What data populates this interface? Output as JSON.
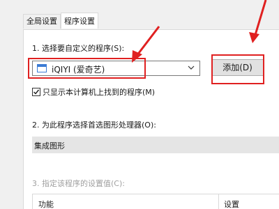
{
  "tabs": [
    {
      "label": "全局设置",
      "active": false
    },
    {
      "label": "程序设置",
      "active": true
    }
  ],
  "section1": {
    "label": "1. 选择要自定义的程序(S):",
    "selected_program": "iQIYI (爱奇艺)",
    "add_button": "添加(D)",
    "checkbox_label": "只显示本计算机上找到的程序(M)",
    "checkbox_checked": true
  },
  "section2": {
    "label": "2. 为此程序选择首选图形处理器(O):",
    "selected_gpu": "集成图形"
  },
  "section3": {
    "label": "3. 指定该程序的设置值(C):",
    "columns": [
      "功能",
      "设置"
    ]
  },
  "annotation_color": "#e02020"
}
